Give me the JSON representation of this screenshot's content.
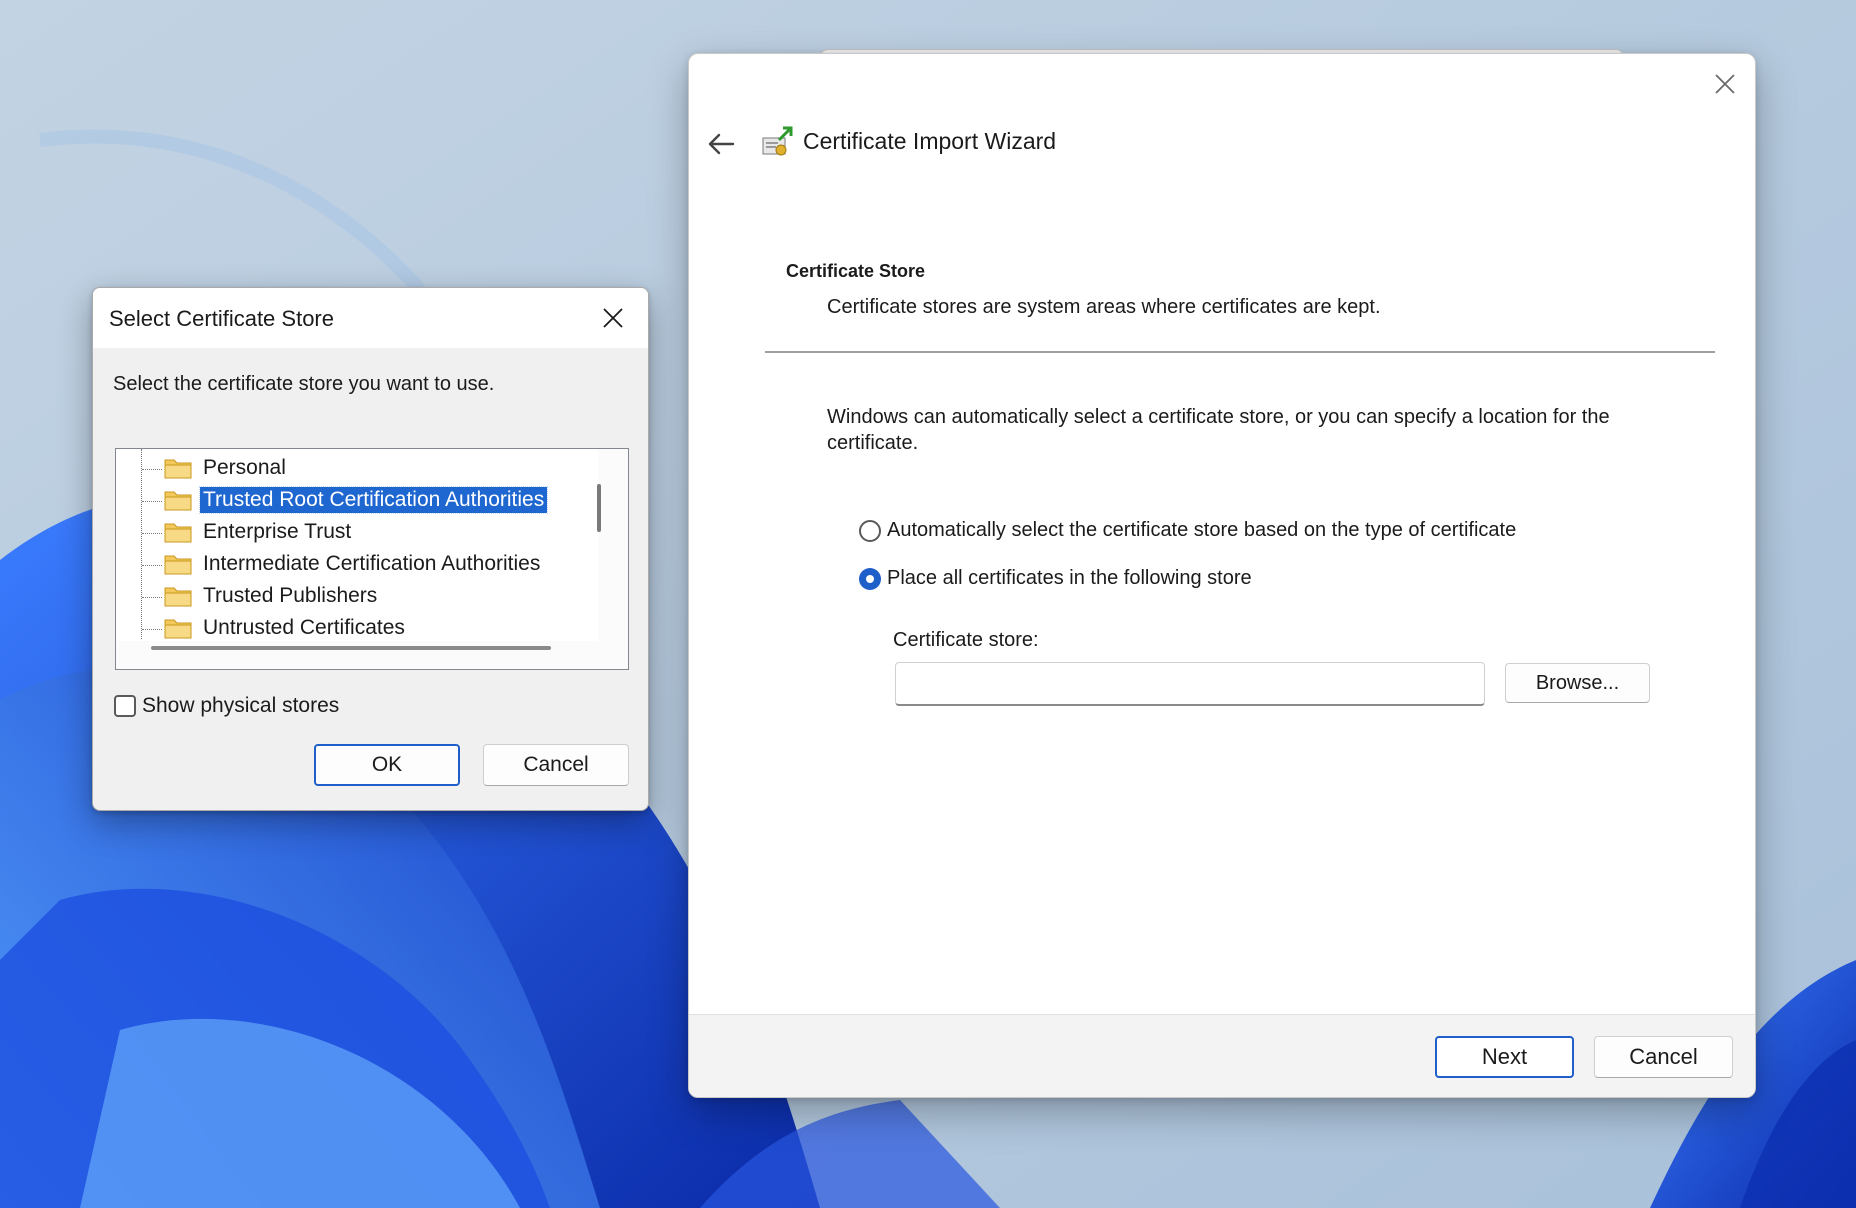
{
  "wizard": {
    "title": "Certificate Import Wizard",
    "icons": {
      "back": "back-arrow-icon",
      "close": "close-icon",
      "app": "certificate-import-icon"
    },
    "section_heading": "Certificate Store",
    "section_description": "Certificate stores are system areas where certificates are kept.",
    "intro": "Windows can automatically select a certificate store, or you can specify a location for the certificate.",
    "options": [
      {
        "label": "Automatically select the certificate store based on the type of certificate",
        "checked": false
      },
      {
        "label": "Place all certificates in the following store",
        "checked": true
      }
    ],
    "store_field_label": "Certificate store:",
    "store_field_value": "",
    "browse_label": "Browse...",
    "next_label": "Next",
    "cancel_label": "Cancel",
    "accent_color": "#1f5fc9"
  },
  "store_dialog": {
    "title": "Select Certificate Store",
    "prompt": "Select the certificate store you want to use.",
    "tree_items": [
      {
        "label": "Personal",
        "selected": false
      },
      {
        "label": "Trusted Root Certification Authorities",
        "selected": true
      },
      {
        "label": "Enterprise Trust",
        "selected": false
      },
      {
        "label": "Intermediate Certification Authorities",
        "selected": false
      },
      {
        "label": "Trusted Publishers",
        "selected": false
      },
      {
        "label": "Untrusted Certificates",
        "selected": false
      }
    ],
    "show_physical_label": "Show physical stores",
    "show_physical_checked": false,
    "ok_label": "OK",
    "cancel_label": "Cancel",
    "selection_color": "#1e66d0"
  }
}
